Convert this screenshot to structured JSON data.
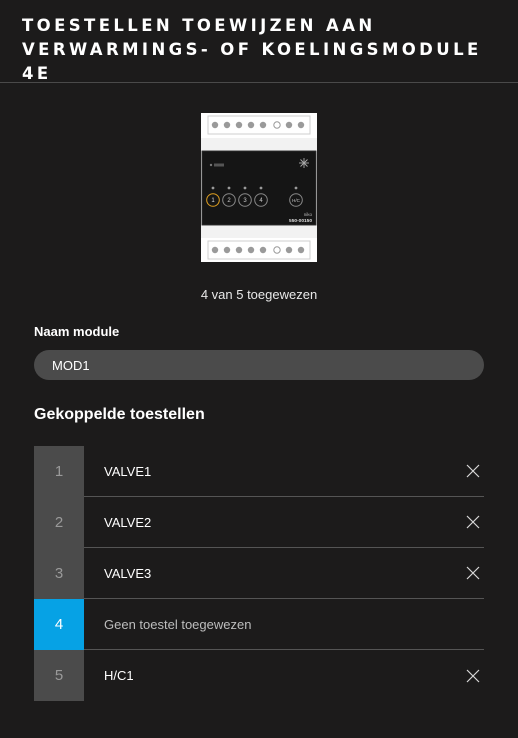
{
  "header": {
    "title": "TOESTELLEN TOEWIJZEN AAN\nVERWARMINGS- OF KOELINGSMODULE 4E"
  },
  "device": {
    "brand_text": "niko",
    "product_code": "550-00150",
    "outputs": [
      "1",
      "2",
      "3",
      "4"
    ],
    "hc_label": "H/C",
    "active_output": "1",
    "accent_color": "#e0a020"
  },
  "assign_count": "4 van 5 toegewezen",
  "module_name": {
    "label": "Naam module",
    "value": "MOD1"
  },
  "linked_devices": {
    "title": "Gekoppelde toestellen",
    "rows": [
      {
        "number": "1",
        "label": "VALVE1",
        "assigned": true
      },
      {
        "number": "2",
        "label": "VALVE2",
        "assigned": true
      },
      {
        "number": "3",
        "label": "VALVE3",
        "assigned": true
      },
      {
        "number": "4",
        "label": "Geen toestel toegewezen",
        "assigned": false
      },
      {
        "number": "5",
        "label": "H/C1",
        "assigned": true
      }
    ]
  },
  "colors": {
    "background": "#1c1b1b",
    "selected": "#06a2e5",
    "cell": "#4b4b4b"
  },
  "icons": {
    "remove": "close-icon"
  }
}
